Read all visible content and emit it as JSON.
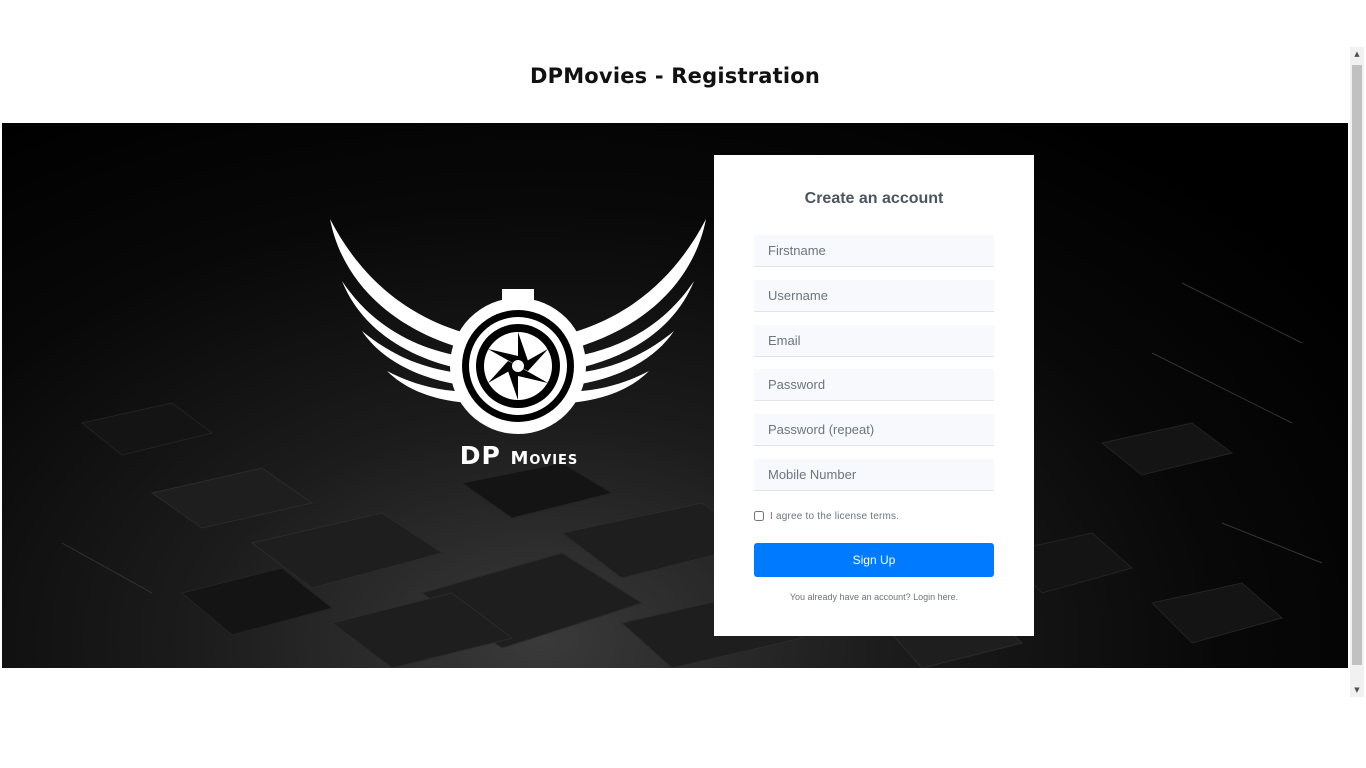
{
  "header": {
    "title_bold": "DP",
    "title_rest": "Movies - Registration"
  },
  "hero": {
    "logo_text_big": "DP",
    "logo_text_small": "Movies"
  },
  "form": {
    "title_bold": "Create",
    "title_rest": " an account",
    "fields": {
      "firstname": "Firstname",
      "username": "Username",
      "email": "Email",
      "password": "Password",
      "password_repeat": "Password (repeat)",
      "mobile": "Mobile Number"
    },
    "agree_label": "I agree to the license terms.",
    "agree_checked": false,
    "submit_label": "Sign Up",
    "login_text": "You already have an account? Login here."
  },
  "colors": {
    "primary": "#007bff",
    "hero_bg": "#000000",
    "card_bg": "#ffffff"
  },
  "icons": {
    "logo": "camera-shutter-wings-icon",
    "scroll_up": "arrow-up-icon",
    "scroll_down": "arrow-down-icon"
  }
}
